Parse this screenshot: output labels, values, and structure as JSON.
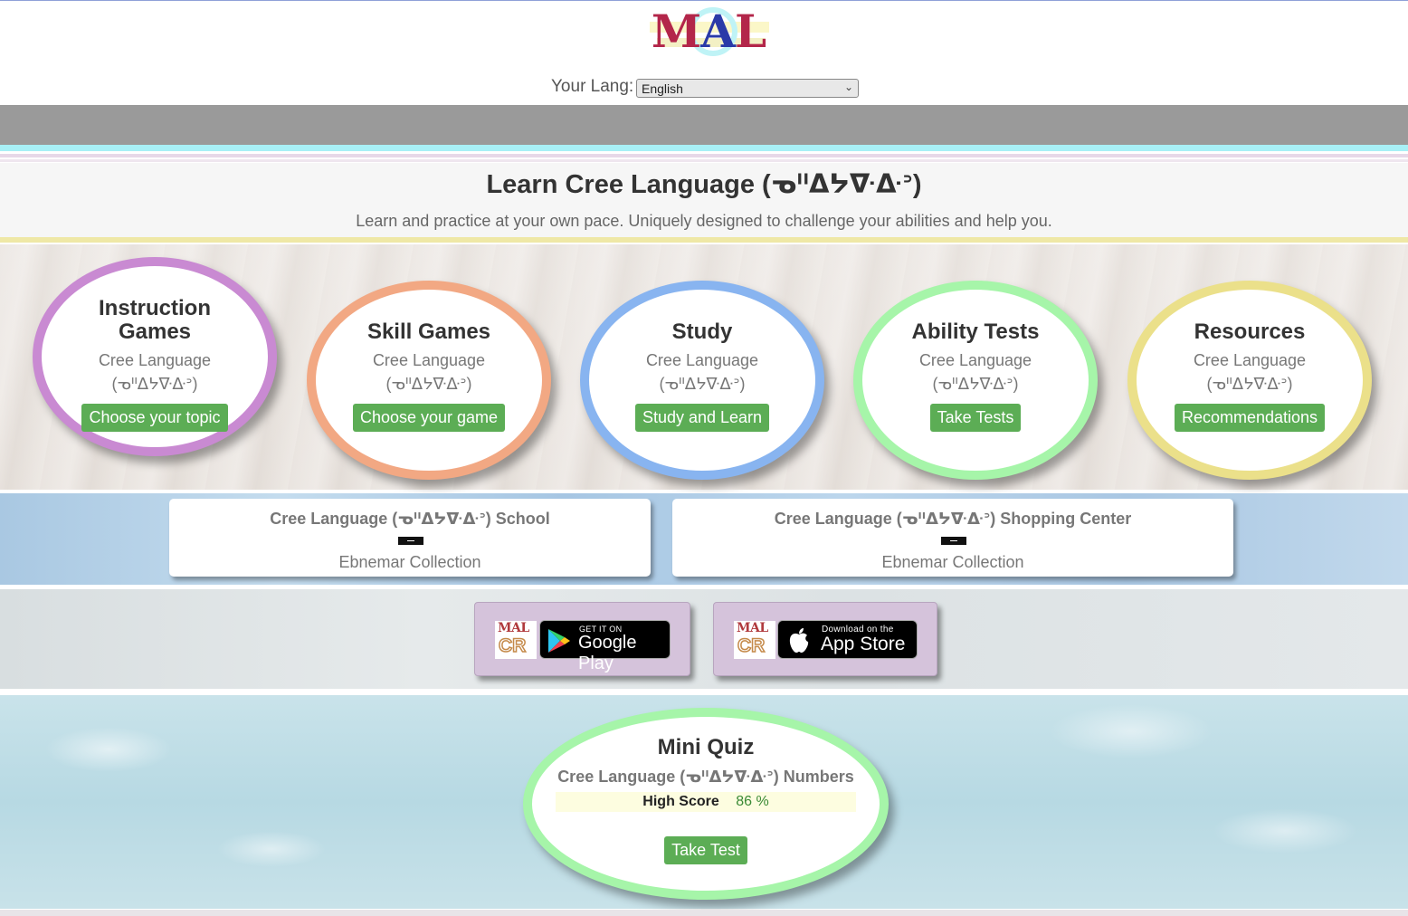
{
  "logo": {
    "letters": [
      "M",
      "A",
      "L"
    ]
  },
  "language": {
    "label": "Your Lang:",
    "selected": "English"
  },
  "hero": {
    "title": "Learn Cree Language (ᓀᐦᐃᔭᐍᐏᐣ)",
    "subtitle": "Learn and practice at your own pace. Uniquely designed to challenge your abilities and help you."
  },
  "cards": [
    {
      "title": "Instruction Games",
      "line1": "Cree Language",
      "line2": "(ᓀᐦᐃᔭᐍᐏᐣ)",
      "button": "Choose your topic",
      "color": "#c98ad2"
    },
    {
      "title": "Skill Games",
      "line1": "Cree Language",
      "line2": "(ᓀᐦᐃᔭᐍᐏᐣ)",
      "button": "Choose your game",
      "color": "#f2a883"
    },
    {
      "title": "Study",
      "line1": "Cree Language",
      "line2": "(ᓀᐦᐃᔭᐍᐏᐣ)",
      "button": "Study and Learn",
      "color": "#88b4f0"
    },
    {
      "title": "Ability Tests",
      "line1": "Cree Language",
      "line2": "(ᓀᐦᐃᔭᐍᐏᐣ)",
      "button": "Take Tests",
      "color": "#a6f5a9"
    },
    {
      "title": "Resources",
      "line1": "Cree Language",
      "line2": "(ᓀᐦᐃᔭᐍᐏᐣ)",
      "button": "Recommendations",
      "color": "#ebe08a"
    }
  ],
  "links": [
    {
      "title": "Cree Language (ᓀᐦᐃᔭᐍᐏᐣ) School",
      "subtitle": "Ebnemar Collection"
    },
    {
      "title": "Cree Language (ᓀᐦᐃᔭᐍᐏᐣ) Shopping Center",
      "subtitle": "Ebnemar Collection"
    }
  ],
  "stores": {
    "app_logo": {
      "top": "MAL",
      "bottom": "CR"
    },
    "google": {
      "small": "GET IT ON",
      "big": "Google Play"
    },
    "apple": {
      "small": "Download on the",
      "big": "App Store"
    }
  },
  "quiz": {
    "title": "Mini Quiz",
    "subtitle": "Cree Language (ᓀᐦᐃᔭᐍᐏᐣ) Numbers",
    "score_label": "High Score",
    "score_value": "86 %",
    "button": "Take Test"
  },
  "colors": {
    "button_green": "#5cad55",
    "header_gray": "#9a9a9a"
  }
}
